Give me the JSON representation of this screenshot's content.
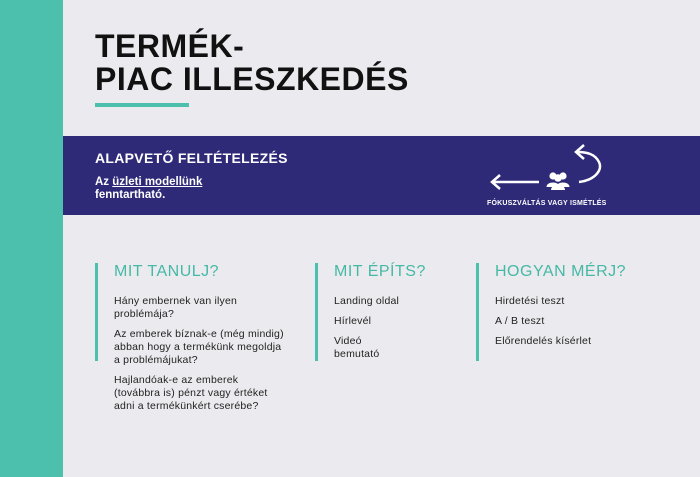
{
  "title": {
    "line1": "TERMÉK-",
    "line2": "PIAC ILLESZKEDÉS"
  },
  "banner": {
    "heading": "ALAPVETŐ FELTÉTELEZÉS",
    "text_prefix": "Az ",
    "text_underlined": "üzleti modellünk",
    "text_suffix": "fenntartható.",
    "cycle_label": "FÓKUSZVÁLTÁS  VAGY  ISMÉTLÉS"
  },
  "columns": [
    {
      "heading": "MIT TANULJ?",
      "items": [
        "Hány embernek van ilyen problémája?",
        "Az emberek bíznak-e (még mindig) abban hogy a termékünk megoldja a problémájukat?",
        "Hajlandóak-e az emberek (továbbra is) pénzt vagy értéket adni a termékünkért cserébe?"
      ]
    },
    {
      "heading": "MIT ÉPÍTS?",
      "items": [
        "Landing oldal",
        "Hírlevél",
        "Videó bemutató"
      ]
    },
    {
      "heading": "HOGYAN MÉRJ?",
      "items": [
        "Hirdetési teszt",
        "A / B teszt",
        "Előrendelés kísérlet"
      ]
    }
  ],
  "colors": {
    "accent": "#4cc0ad",
    "banner": "#2e2a78",
    "background": "#ebebef"
  },
  "icons": [
    "people-icon",
    "pivot-arrow-icon",
    "repeat-arrow-icon"
  ]
}
